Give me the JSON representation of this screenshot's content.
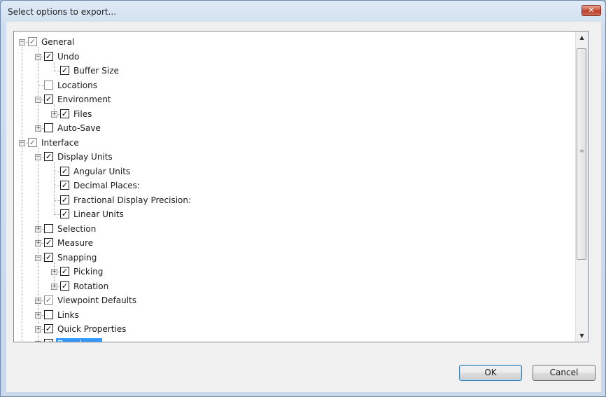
{
  "dialog": {
    "title": "Select options to export...",
    "close_glyph": "✕",
    "ok_label": "OK",
    "cancel_label": "Cancel"
  },
  "tree": {
    "items": [
      {
        "label": "General",
        "depth": 0,
        "expander": "minus",
        "state": "gray"
      },
      {
        "label": "Undo",
        "depth": 1,
        "expander": "minus",
        "state": "checked"
      },
      {
        "label": "Buffer Size",
        "depth": 2,
        "expander": "none",
        "state": "checked"
      },
      {
        "label": "Locations",
        "depth": 1,
        "expander": "none",
        "state": "empty-gray"
      },
      {
        "label": "Environment",
        "depth": 1,
        "expander": "minus",
        "state": "checked"
      },
      {
        "label": "Files",
        "depth": 2,
        "expander": "plus",
        "state": "checked"
      },
      {
        "label": "Auto-Save",
        "depth": 1,
        "expander": "plus",
        "state": "empty"
      },
      {
        "label": "Interface",
        "depth": 0,
        "expander": "minus",
        "state": "gray"
      },
      {
        "label": "Display Units",
        "depth": 1,
        "expander": "minus",
        "state": "checked"
      },
      {
        "label": "Angular Units",
        "depth": 2,
        "expander": "none",
        "state": "checked"
      },
      {
        "label": "Decimal Places:",
        "depth": 2,
        "expander": "none",
        "state": "checked"
      },
      {
        "label": "Fractional Display Precision:",
        "depth": 2,
        "expander": "none",
        "state": "checked"
      },
      {
        "label": "Linear Units",
        "depth": 2,
        "expander": "none",
        "state": "checked"
      },
      {
        "label": "Selection",
        "depth": 1,
        "expander": "plus",
        "state": "empty"
      },
      {
        "label": "Measure",
        "depth": 1,
        "expander": "plus",
        "state": "checked"
      },
      {
        "label": "Snapping",
        "depth": 1,
        "expander": "minus",
        "state": "checked"
      },
      {
        "label": "Picking",
        "depth": 2,
        "expander": "plus",
        "state": "checked"
      },
      {
        "label": "Rotation",
        "depth": 2,
        "expander": "plus",
        "state": "checked"
      },
      {
        "label": "Viewpoint Defaults",
        "depth": 1,
        "expander": "plus",
        "state": "gray"
      },
      {
        "label": "Links",
        "depth": 1,
        "expander": "plus",
        "state": "empty"
      },
      {
        "label": "Quick Properties",
        "depth": 1,
        "expander": "plus",
        "state": "checked"
      },
      {
        "label": "Developer",
        "depth": 1,
        "expander": "plus",
        "state": "checked",
        "selected": true
      }
    ]
  },
  "colors": {
    "selection": "#3399ff",
    "title_gradient_top": "#dfeaf6"
  }
}
